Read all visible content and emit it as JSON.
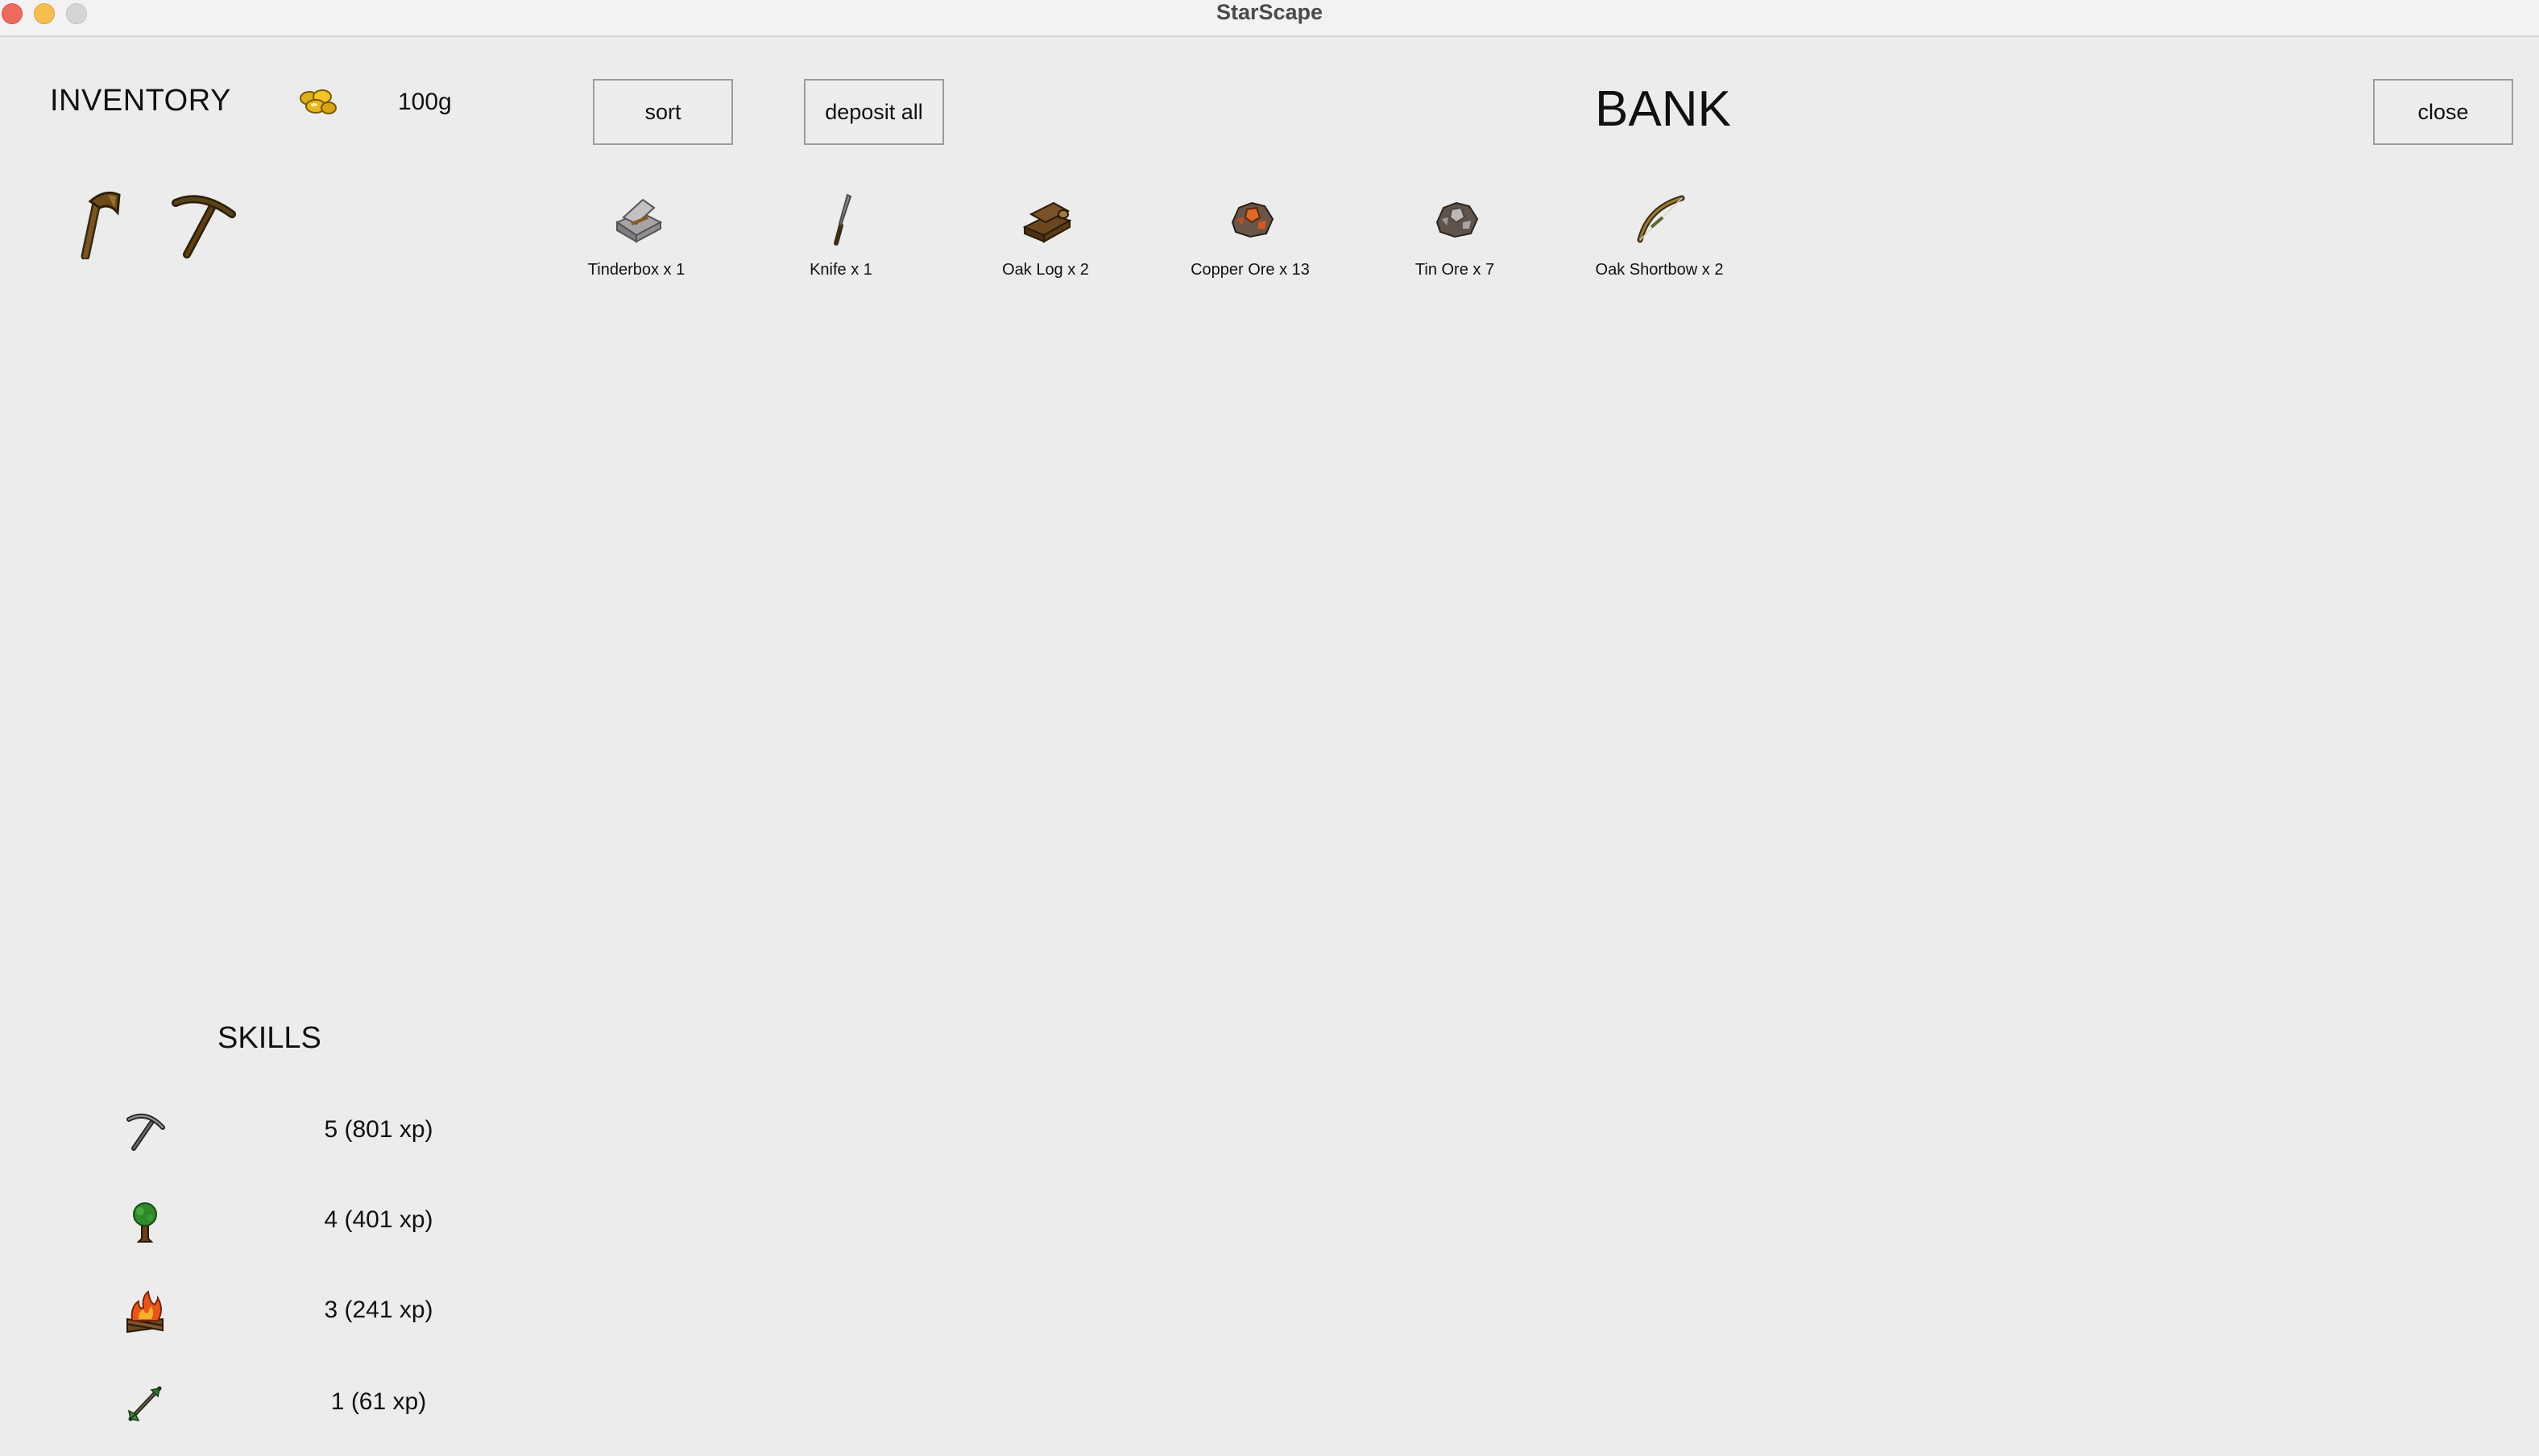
{
  "window": {
    "title": "StarScape"
  },
  "inventory": {
    "title": "INVENTORY",
    "gold": "100g",
    "gold_icon": "gold-coins-icon",
    "items": [
      {
        "name": "hatchet",
        "icon": "hatchet-icon"
      },
      {
        "name": "pickaxe",
        "icon": "pickaxe-icon"
      }
    ]
  },
  "toolbar": {
    "sort_label": "sort",
    "deposit_label": "deposit all",
    "close_label": "close"
  },
  "bank": {
    "title": "BANK",
    "items": [
      {
        "label": "Tinderbox x 1",
        "icon": "tinderbox-icon"
      },
      {
        "label": "Knife x 1",
        "icon": "knife-icon"
      },
      {
        "label": "Oak Log x 2",
        "icon": "oak-log-icon"
      },
      {
        "label": "Copper Ore x 13",
        "icon": "copper-ore-icon"
      },
      {
        "label": "Tin Ore x 7",
        "icon": "tin-ore-icon"
      },
      {
        "label": "Oak Shortbow x 2",
        "icon": "oak-shortbow-icon"
      }
    ]
  },
  "skills": {
    "title": "SKILLS",
    "items": [
      {
        "icon": "mining-pickaxe-icon",
        "value": "5 (801 xp)"
      },
      {
        "icon": "woodcutting-tree-icon",
        "value": "4 (401 xp)"
      },
      {
        "icon": "firemaking-fire-icon",
        "value": "3 (241 xp)"
      },
      {
        "icon": "fletching-arrow-icon",
        "value": "1 (61 xp)"
      }
    ]
  },
  "colors": {
    "background": "#ececec",
    "titlebar": "#f4f1f3",
    "close_light": "#ee6a5f",
    "minimize_light": "#f5bf4f",
    "zoom_light": "#d6d4d5"
  }
}
